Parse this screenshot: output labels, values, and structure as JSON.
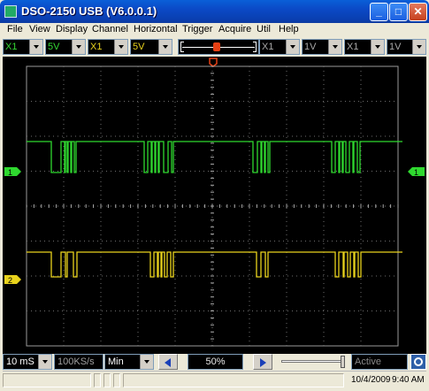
{
  "window": {
    "title": "DSO-2150 USB (V6.0.0.1)"
  },
  "menu": [
    "File",
    "View",
    "Display",
    "Channel",
    "Horizontal",
    "Trigger",
    "Acquire",
    "Util",
    "Help"
  ],
  "toolbar": {
    "ch1_probe": "X1",
    "ch1_volts": "5V",
    "ch2_probe": "X1",
    "ch2_volts": "5V",
    "ref1_probe": "X1",
    "ref1_volts": "1V",
    "ref2_probe": "X1",
    "ref2_volts": "1V"
  },
  "colors": {
    "ch1": "#2fd92f",
    "ch2": "#e9d31c",
    "trigger": "#e64014",
    "grid": "#6e6e6e"
  },
  "channels": {
    "ch1_marker": "1",
    "ch2_marker": "2"
  },
  "bottom": {
    "timebase": "10 mS",
    "sample_rate": "100KS/s",
    "mode": "Min",
    "zoom": "50%",
    "status": "Active"
  },
  "statusbar": {
    "date": "10/4/2009",
    "time": "9:40 AM"
  }
}
